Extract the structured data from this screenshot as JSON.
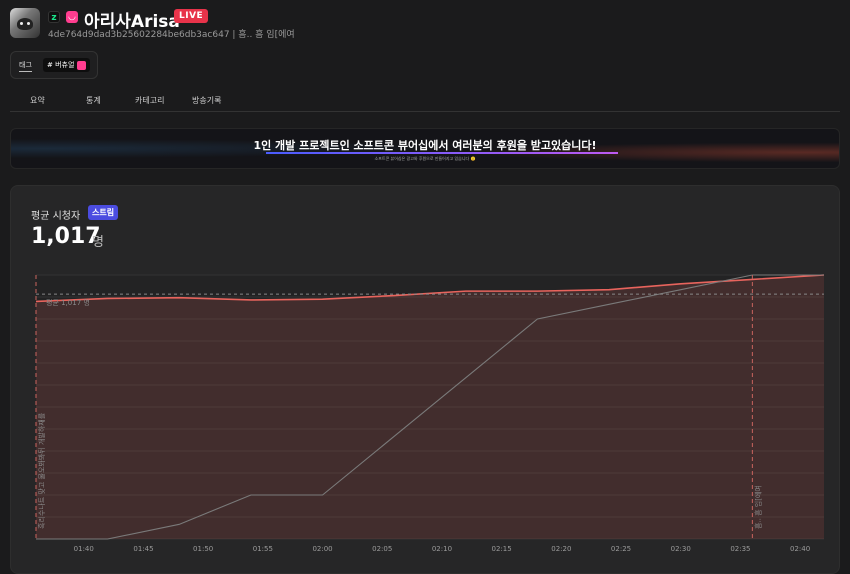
{
  "header": {
    "title": "아리사Arisa",
    "live_label": "LIVE",
    "subtitle": "4de764d9dad3b25602284be6db3ac647 | 흠.. 흠 임[에여"
  },
  "tags": {
    "label": "태그",
    "chip": "# 버츄얼"
  },
  "tabs": [
    "요약",
    "통계",
    "카테고리",
    "방송기록"
  ],
  "banner": {
    "main": "1인 개발 프로젝트인 소프트콘 뷰어십에서 여러분의 후원을 받고있습니다!",
    "sub": "소프트콘 뷰어십은 광고와 후원으로 만들어지고 있습니다 🙂"
  },
  "stats": {
    "label": "평균 시청자",
    "badge": "스트림",
    "value": "1,017",
    "unit": "명"
  },
  "chart_data": {
    "type": "line",
    "x_labels": [
      "01:40",
      "01:45",
      "01:50",
      "01:55",
      "02:00",
      "02:05",
      "02:10",
      "02:15",
      "02:20",
      "02:25",
      "02:30",
      "02:35",
      "02:40"
    ],
    "xlim": [
      "01:36",
      "02:42"
    ],
    "series": [
      {
        "color": "#e8645d",
        "x": [
          "01:36",
          "01:42",
          "01:48",
          "01:54",
          "02:00",
          "02:06",
          "02:12",
          "02:18",
          "02:24",
          "02:30",
          "02:36",
          "02:42"
        ],
        "values": [
          1012,
          1014,
          1014.5,
          1013,
          1013.5,
          1016,
          1019,
          1019,
          1020,
          1024,
          1027,
          1030
        ]
      },
      {
        "color": "#7a7a7a",
        "x": [
          "01:36",
          "01:42",
          "01:48",
          "01:54",
          "02:00",
          "02:06",
          "02:12",
          "02:18",
          "02:24",
          "02:30",
          "02:36",
          "02:42"
        ],
        "values": [
          850,
          850,
          860,
          880,
          880,
          920,
          960,
          1000,
          1010,
          1020,
          1030,
          1030
        ]
      }
    ],
    "ylim": [
      850,
      1030
    ],
    "average": {
      "value": 1017,
      "label": "평균 1,017 명"
    },
    "markers": [
      {
        "x": "01:36",
        "label": "흑리수나트 맞고 물오봐봐뒤 개발하재를"
      },
      {
        "x": "02:36",
        "label": "흠.. 흠 임[에여"
      }
    ],
    "grid": true
  }
}
